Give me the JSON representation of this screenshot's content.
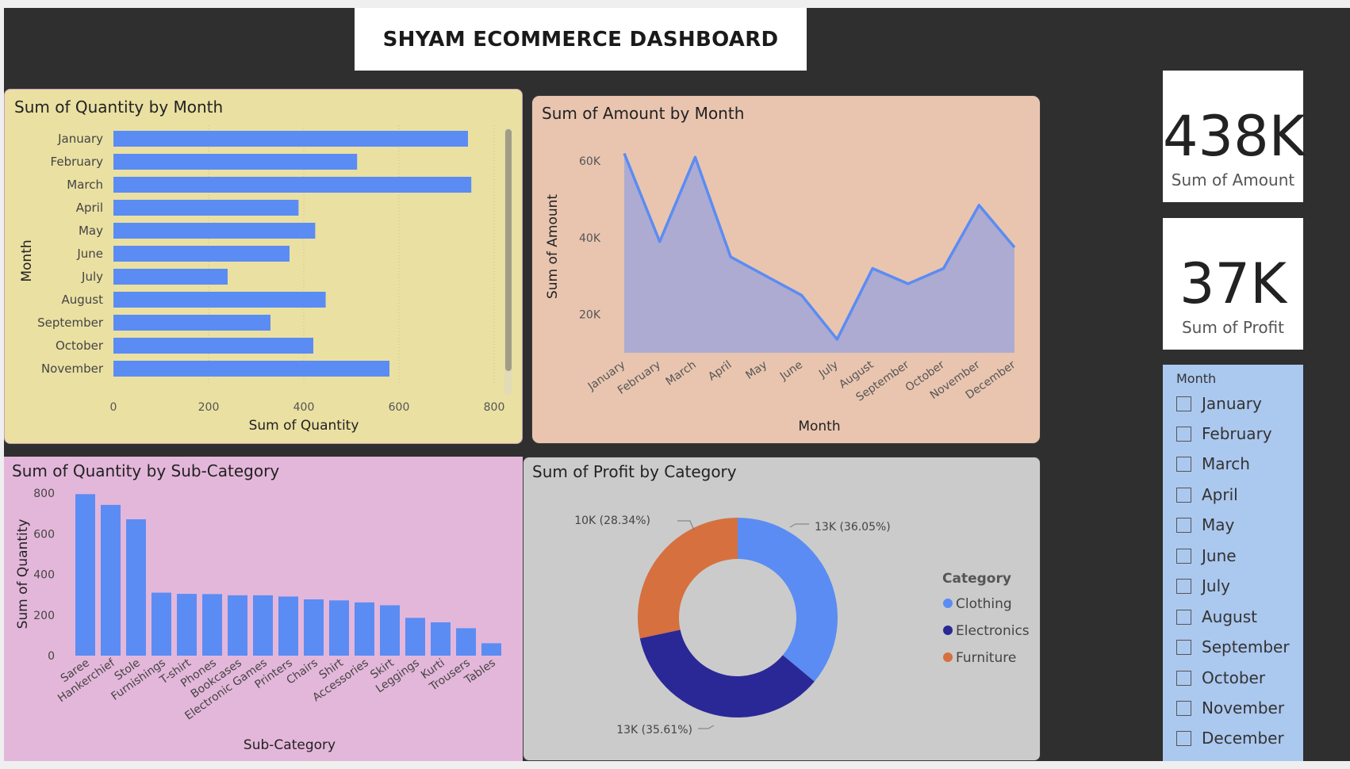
{
  "dashboard": {
    "title": "SHYAM ECOMMERCE DASHBOARD"
  },
  "colors": {
    "canvas": "#2f2f2f",
    "bar": "#5b8cf3",
    "panel_yellow": "#eae0a2",
    "panel_peach": "#e9c5b0",
    "panel_pink": "#e3b7da",
    "panel_gray": "#cbcbcb",
    "slicer": "#abc8ef",
    "clothing": "#5b8cf3",
    "electronics": "#2a2897",
    "furniture": "#d6703f"
  },
  "cards": {
    "amount": {
      "value": "438K",
      "label": "Sum of Amount"
    },
    "profit": {
      "value": "37K",
      "label": "Sum of Profit"
    }
  },
  "slicer": {
    "header": "Month",
    "items": [
      "January",
      "February",
      "March",
      "April",
      "May",
      "June",
      "July",
      "August",
      "September",
      "October",
      "November",
      "December"
    ]
  },
  "chart_data": [
    {
      "type": "bar",
      "orientation": "horizontal",
      "title": "Sum of Quantity by Month",
      "xlabel": "Sum of Quantity",
      "ylabel": "Month",
      "categories": [
        "January",
        "February",
        "March",
        "April",
        "May",
        "June",
        "July",
        "August",
        "September",
        "October",
        "November"
      ],
      "values": [
        745,
        512,
        752,
        389,
        424,
        370,
        240,
        446,
        330,
        420,
        580
      ],
      "xlim": [
        0,
        800
      ],
      "xticks": [
        0,
        200,
        400,
        600,
        800
      ],
      "xtick_labels": [
        "0",
        "200",
        "400",
        "600",
        "800"
      ],
      "grid": true
    },
    {
      "type": "area",
      "title": "Sum of Amount by Month",
      "xlabel": "Month",
      "ylabel": "Sum of Amount",
      "categories": [
        "January",
        "February",
        "March",
        "April",
        "May",
        "June",
        "July",
        "August",
        "September",
        "October",
        "November",
        "December"
      ],
      "values": [
        62000,
        39000,
        61000,
        35000,
        30000,
        25000,
        13500,
        32000,
        28000,
        32000,
        48500,
        37500
      ],
      "ylim": [
        10000,
        65000
      ],
      "yticks": [
        20000,
        40000,
        60000
      ],
      "ytick_labels": [
        "20K",
        "40K",
        "60K"
      ]
    },
    {
      "type": "bar",
      "title": "Sum of Quantity by Sub-Category",
      "xlabel": "Sub-Category",
      "ylabel": "Sum of Quantity",
      "categories": [
        "Saree",
        "Hankerchief",
        "Stole",
        "Furnishings",
        "T-shirt",
        "Phones",
        "Bookcases",
        "Electronic Games",
        "Printers",
        "Chairs",
        "Shirt",
        "Accessories",
        "Skirt",
        "Leggings",
        "Kurti",
        "Trousers",
        "Tables"
      ],
      "values": [
        795,
        742,
        671,
        310,
        304,
        303,
        297,
        297,
        291,
        277,
        272,
        262,
        248,
        186,
        164,
        135,
        61
      ],
      "ylim": [
        0,
        800
      ],
      "yticks": [
        0,
        200,
        400,
        600,
        800
      ],
      "ytick_labels": [
        "0",
        "200",
        "400",
        "600",
        "800"
      ]
    },
    {
      "type": "pie",
      "donut": true,
      "title": "Sum of Profit by Category",
      "legend_title": "Category",
      "legend_position": "right",
      "labels": [
        "Clothing",
        "Electronics",
        "Furniture"
      ],
      "values": [
        36.05,
        35.61,
        28.34
      ],
      "data_labels": [
        "13K (36.05%)",
        "13K (35.61%)",
        "10K (28.34%)"
      ]
    }
  ]
}
